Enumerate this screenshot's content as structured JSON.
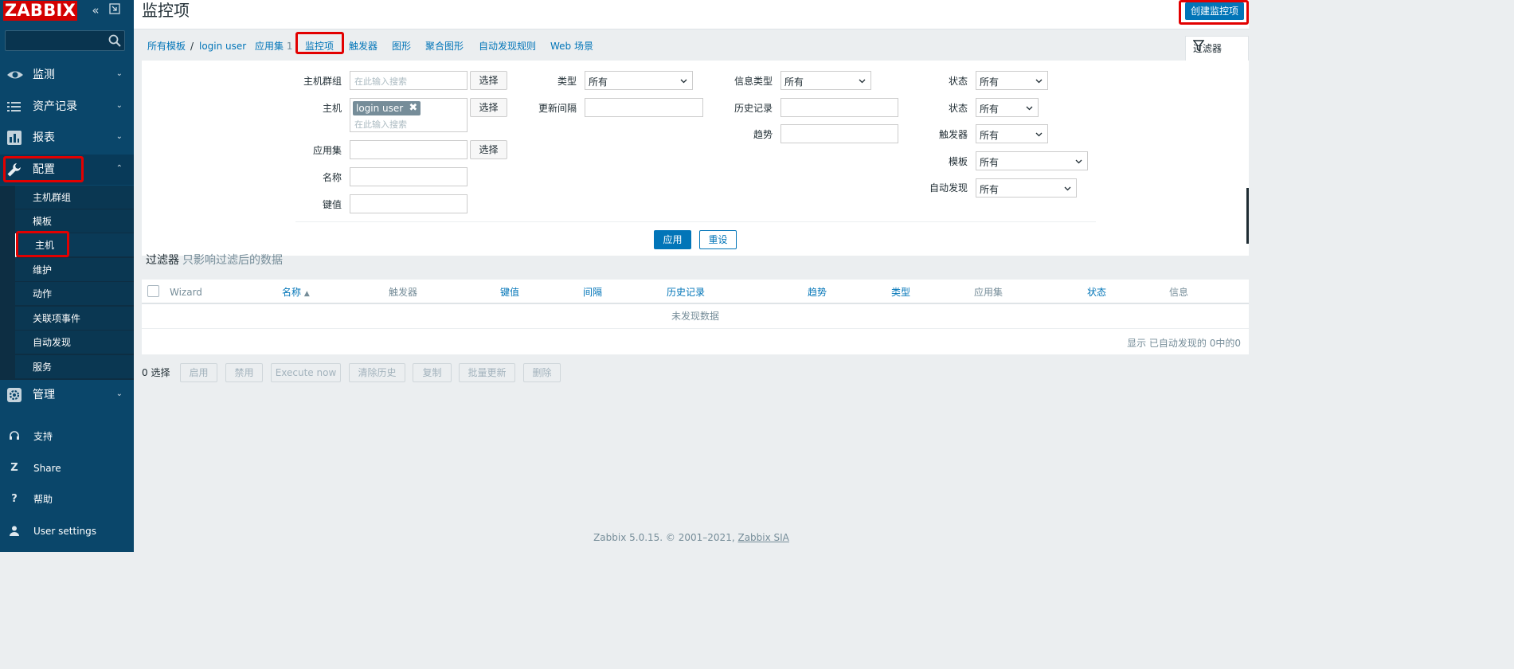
{
  "sidebar": {
    "logo": "ZABBIX",
    "menus": [
      {
        "label": "监测",
        "icon": "eye-icon"
      },
      {
        "label": "资产记录",
        "icon": "list-icon"
      },
      {
        "label": "报表",
        "icon": "bar-chart-icon"
      },
      {
        "label": "配置",
        "icon": "wrench-icon"
      },
      {
        "label": "管理",
        "icon": "gear-icon"
      }
    ],
    "submenu": [
      "主机群组",
      "模板",
      "主机",
      "维护",
      "动作",
      "关联项事件",
      "自动发现",
      "服务"
    ],
    "bottom": [
      {
        "label": "支持",
        "icon": "headset-icon"
      },
      {
        "label": "Share",
        "icon": "share-z-icon"
      },
      {
        "label": "帮助",
        "icon": "question-icon"
      },
      {
        "label": "User settings",
        "icon": "user-icon"
      }
    ]
  },
  "header": {
    "title": "监控项",
    "create_button": "创建监控项"
  },
  "nav": {
    "breadcrumb_all": "所有模板",
    "separator": "/",
    "host": "login user",
    "applications": "应用集",
    "applications_count": "1",
    "tabs": [
      "监控项",
      "触发器",
      "图形",
      "聚合图形",
      "自动发现规则",
      "Web 场景"
    ],
    "filter_tab": "过滤器"
  },
  "filter": {
    "col1": {
      "host_groups_label": "主机群组",
      "host_groups_placeholder": "在此输入搜索",
      "hosts_label": "主机",
      "host_tag": "login user",
      "hosts_placeholder": "在此输入搜索",
      "applications_label": "应用集",
      "name_label": "名称",
      "key_label": "键值",
      "select_button": "选择"
    },
    "col2": {
      "type_label": "类型",
      "type_value": "所有",
      "update_interval_label": "更新间隔"
    },
    "col3": {
      "info_type_label": "信息类型",
      "info_type_value": "所有",
      "history_label": "历史记录",
      "trends_label": "趋势"
    },
    "col4": {
      "state_label": "状态",
      "state_value": "所有",
      "status_label": "状态",
      "status_value": "所有",
      "triggers_label": "触发器",
      "triggers_value": "所有",
      "template_label": "模板",
      "template_value": "所有",
      "discovery_label": "自动发现",
      "discovery_value": "所有"
    },
    "apply_button": "应用",
    "reset_button": "重设"
  },
  "filter_info": {
    "title": "过滤器",
    "note": "只影响过滤后的数据"
  },
  "table": {
    "columns": [
      {
        "label": "Wizard",
        "link": false
      },
      {
        "label": "名称",
        "link": true,
        "sort": "▲"
      },
      {
        "label": "触发器",
        "link": false
      },
      {
        "label": "键值",
        "link": true
      },
      {
        "label": "间隔",
        "link": true
      },
      {
        "label": "历史记录",
        "link": true
      },
      {
        "label": "趋势",
        "link": true
      },
      {
        "label": "类型",
        "link": true
      },
      {
        "label": "应用集",
        "link": false
      },
      {
        "label": "状态",
        "link": true
      },
      {
        "label": "信息",
        "link": false
      }
    ],
    "no_data": "未发现数据",
    "footer": "显示 已自动发现的 0中的0"
  },
  "mass_actions": {
    "selected": "0 选择",
    "buttons": [
      "启用",
      "禁用",
      "Execute now",
      "清除历史",
      "复制",
      "批量更新",
      "删除"
    ]
  },
  "footer": {
    "text": "Zabbix 5.0.15. © 2001–2021, ",
    "link": "Zabbix SIA"
  },
  "colors": {
    "sidebar": "#0a466a",
    "accent": "#0275b8",
    "highlight": "#e20000",
    "logo": "#d40000"
  }
}
